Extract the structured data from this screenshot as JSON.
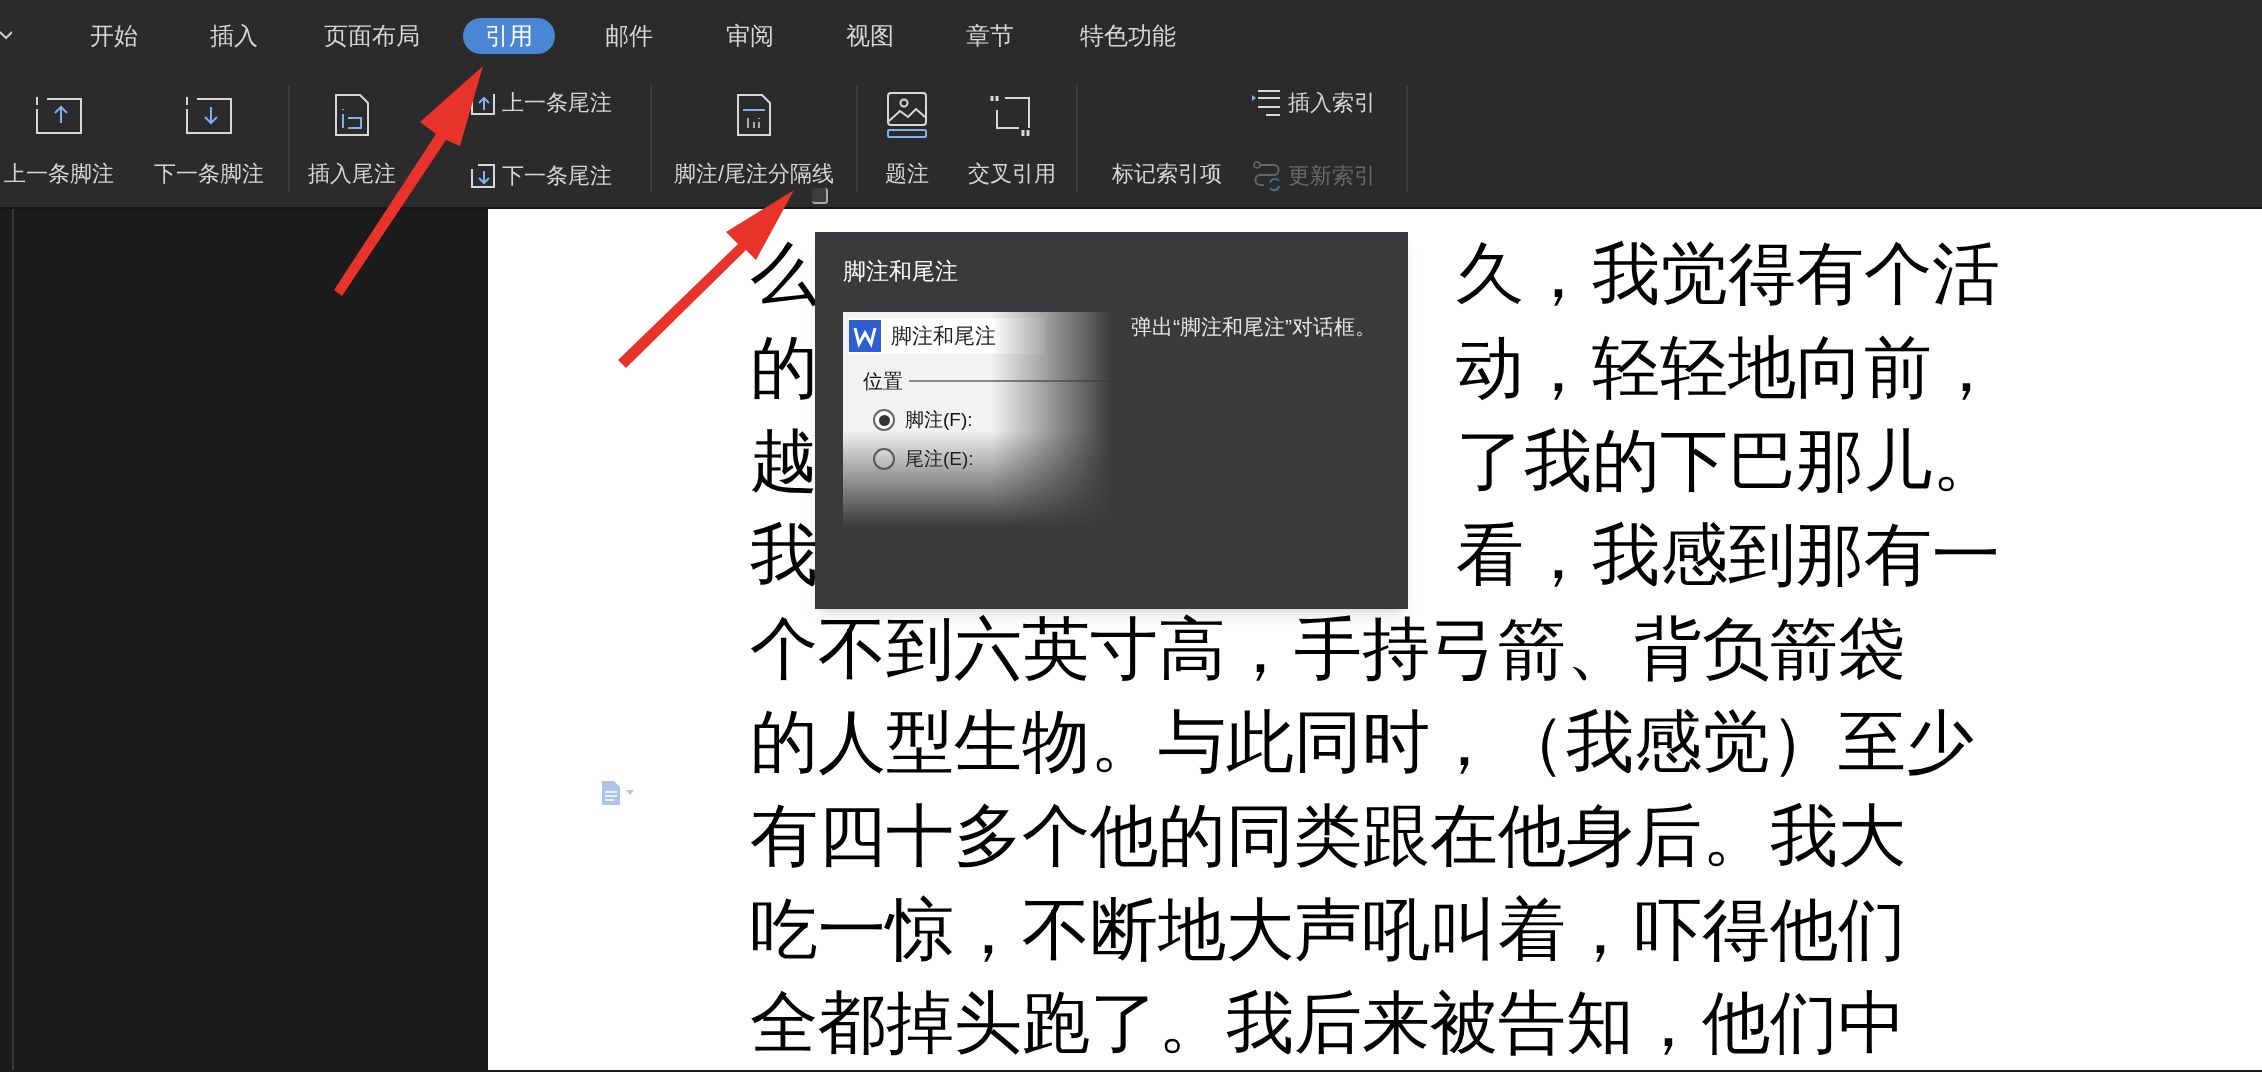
{
  "tabs": [
    {
      "label": "开始",
      "selected": false
    },
    {
      "label": "插入",
      "selected": false
    },
    {
      "label": "页面布局",
      "selected": false
    },
    {
      "label": "引用",
      "selected": true
    },
    {
      "label": "邮件",
      "selected": false
    },
    {
      "label": "审阅",
      "selected": false
    },
    {
      "label": "视图",
      "selected": false
    },
    {
      "label": "章节",
      "selected": false
    },
    {
      "label": "特色功能",
      "selected": false
    }
  ],
  "toolbar": {
    "groups": [
      {
        "items": [
          {
            "kind": "large",
            "label": "上一条脚注"
          },
          {
            "kind": "large",
            "label": "下一条脚注"
          }
        ]
      },
      {
        "items": [
          {
            "kind": "large",
            "label": "插入尾注"
          },
          {
            "kind": "stack",
            "buttons": [
              {
                "label": "上一条尾注",
                "disabled": false
              },
              {
                "label": "下一条尾注",
                "disabled": false
              }
            ]
          }
        ]
      },
      {
        "items": [
          {
            "kind": "large",
            "label": "脚注/尾注分隔线"
          }
        ]
      },
      {
        "items": [
          {
            "kind": "large",
            "label": "题注"
          },
          {
            "kind": "large",
            "label": "交叉引用"
          }
        ]
      },
      {
        "items": [
          {
            "kind": "large",
            "label": "标记索引项"
          },
          {
            "kind": "stack",
            "buttons": [
              {
                "label": "插入索引",
                "disabled": false
              },
              {
                "label": "更新索引",
                "disabled": true
              }
            ]
          }
        ]
      }
    ]
  },
  "document": {
    "lines": [
      {
        "segments": [
          "么",
          "久，我觉得有个活"
        ]
      },
      {
        "segments": [
          "的",
          "动，轻轻地向前，"
        ]
      },
      {
        "segments": [
          "越",
          "了我的下巴那儿。"
        ]
      },
      {
        "segments": [
          "我",
          "看，我感到那有一"
        ]
      },
      {
        "segments": [
          "个不到六英寸高，手持弓箭、背负箭袋"
        ]
      },
      {
        "segments": [
          "的人型生物。与此同时，（我感觉）至少"
        ]
      },
      {
        "segments": [
          "有四十多个他的同类跟在他身后。我大"
        ]
      },
      {
        "segments": [
          "吃一惊，不断地大声吼叫着，吓得他们"
        ]
      },
      {
        "segments": [
          "全都掉头跑了。我后来被告知，他们中"
        ]
      }
    ]
  },
  "tooltip": {
    "title": "脚注和尾注",
    "preview": {
      "title": "脚注和尾注",
      "section": "位置",
      "options": [
        {
          "label": "脚注(F):",
          "selected": true
        },
        {
          "label": "尾注(E):",
          "selected": false
        }
      ]
    },
    "description": "弹出“脚注和尾注”对话框。"
  }
}
